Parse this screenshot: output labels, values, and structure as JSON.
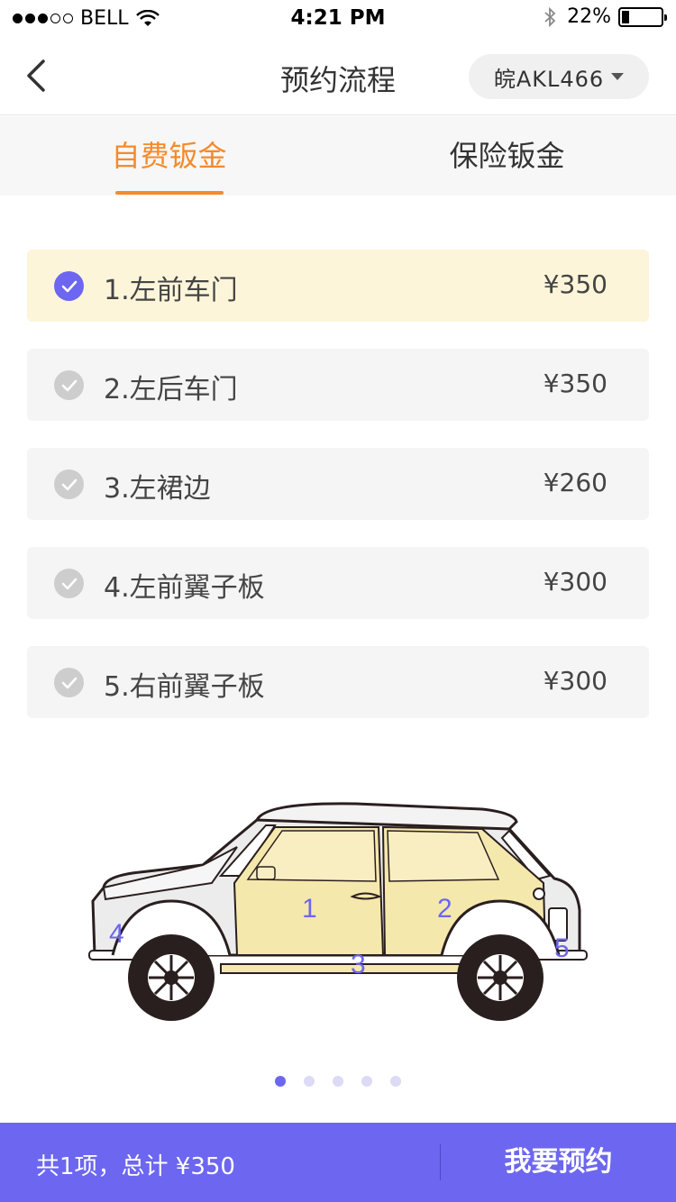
{
  "status": {
    "carrier": "BELL",
    "time": "4:21 PM",
    "battery": "22%",
    "signal_bars_filled": 3
  },
  "nav": {
    "title": "预约流程",
    "plate": "皖AKL466"
  },
  "tabs": [
    {
      "label": "自费钣金",
      "active": true
    },
    {
      "label": "保险钣金",
      "active": false
    }
  ],
  "items": [
    {
      "label": "1.左前车门",
      "price": "¥350",
      "selected": true
    },
    {
      "label": "2.左后车门",
      "price": "¥350",
      "selected": false
    },
    {
      "label": "3.左裙边",
      "price": "¥260",
      "selected": false
    },
    {
      "label": "4.左前翼子板",
      "price": "¥300",
      "selected": false
    },
    {
      "label": "5.右前翼子板",
      "price": "¥300",
      "selected": false
    }
  ],
  "car_labels": [
    "1",
    "2",
    "3",
    "4",
    "5"
  ],
  "pager": {
    "count": 5,
    "active_index": 0
  },
  "bottom": {
    "summary": "共1项，总计 ¥350",
    "book_label": "我要预约"
  },
  "colors": {
    "accent": "#6c66f0",
    "tab_active": "#f58a2b",
    "selected_bg": "#fdf5d9"
  }
}
